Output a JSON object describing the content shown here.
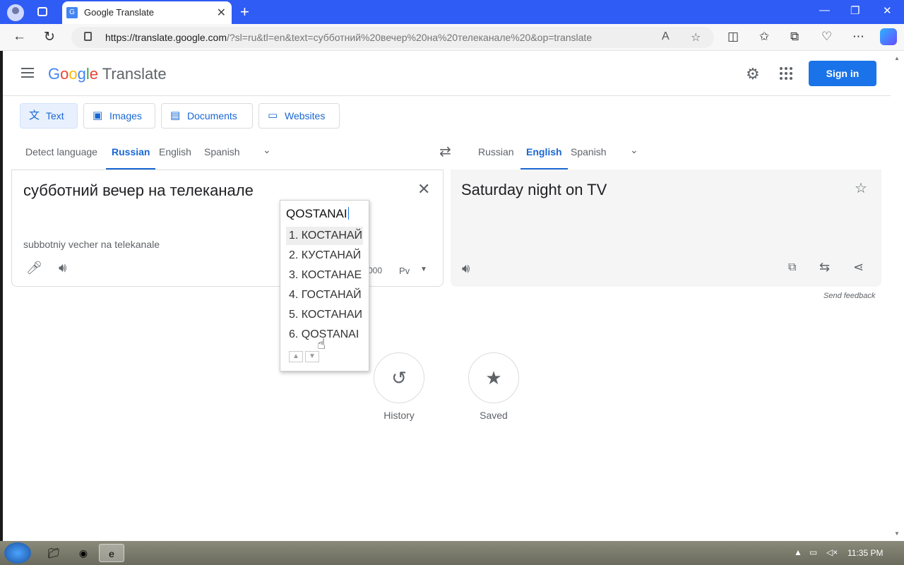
{
  "browser": {
    "tab_title": "Google Translate",
    "url_host": "https://translate.google.com",
    "url_rest": "/?sl=ru&tl=en&text=субботний%20вечер%20на%20телеканале%20&op=translate"
  },
  "header": {
    "logo_word": "Google",
    "logo_product": "Translate",
    "signin_label": "Sign in"
  },
  "modes": [
    {
      "label": "Text"
    },
    {
      "label": "Images"
    },
    {
      "label": "Documents"
    },
    {
      "label": "Websites"
    }
  ],
  "source_langs": [
    {
      "label": "Detect language"
    },
    {
      "label": "Russian"
    },
    {
      "label": "English"
    },
    {
      "label": "Spanish"
    }
  ],
  "target_langs": [
    {
      "label": "Russian"
    },
    {
      "label": "English"
    },
    {
      "label": "Spanish"
    }
  ],
  "source": {
    "text": "субботний вечер на телеканале",
    "transliteration": "subbotniy vecher na telekanale",
    "char_count": "000",
    "keyboard_label": "Рv"
  },
  "target": {
    "text": "Saturday night on TV",
    "send_feedback": "Send feedback"
  },
  "ime": {
    "composition": "QOSTANAI",
    "candidates": [
      "1. КОСТАНАЙ",
      "2. КУСТАНАЙ",
      "3. КОСТАНАЕ",
      "4. ГОСТАНАЙ",
      "5. КОСТАНАИ",
      "6. QOSTANAI"
    ]
  },
  "shortcuts": {
    "history_label": "History",
    "saved_label": "Saved"
  },
  "taskbar": {
    "clock": "11:35 PM"
  },
  "colors": {
    "accent": "#1a73e8",
    "titlebar": "#2f5cf5"
  }
}
